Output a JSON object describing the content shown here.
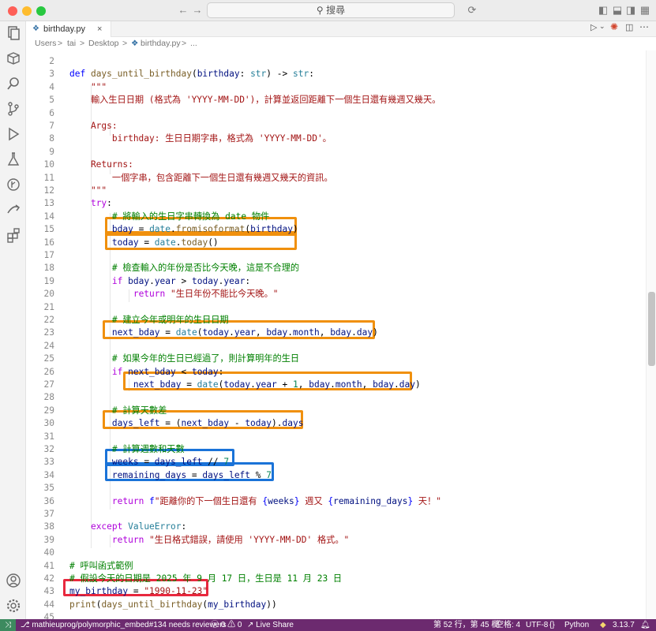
{
  "titlebar": {
    "search": "搜尋"
  },
  "tab": {
    "filename": "birthday.py"
  },
  "breadcrumb": {
    "users": "Users",
    "sep": ">",
    "user": "tai",
    "desktop": "Desktop",
    "file": "birthday.py",
    "more": "..."
  },
  "code_lines": [
    {
      "n": "2",
      "tokens": []
    },
    {
      "n": "3",
      "tokens": [
        [
          "kw",
          "def "
        ],
        [
          "fn",
          "days_until_birthday"
        ],
        [
          "pl",
          "("
        ],
        [
          "var",
          "birthday"
        ],
        [
          "pl",
          ": "
        ],
        [
          "cls",
          "str"
        ],
        [
          "pl",
          ") -> "
        ],
        [
          "cls",
          "str"
        ],
        [
          "pl",
          ":"
        ]
      ]
    },
    {
      "n": "4",
      "tokens": [
        [
          "str",
          "    \"\"\""
        ]
      ]
    },
    {
      "n": "5",
      "tokens": [
        [
          "str",
          "    輸入生日日期 (格式為 'YYYY-MM-DD')，計算並返回距離下一個生日還有幾週又幾天。"
        ]
      ]
    },
    {
      "n": "6",
      "tokens": []
    },
    {
      "n": "7",
      "tokens": [
        [
          "str",
          "    Args:"
        ]
      ]
    },
    {
      "n": "8",
      "tokens": [
        [
          "str",
          "        birthday: 生日日期字串，格式為 'YYYY-MM-DD'。"
        ]
      ]
    },
    {
      "n": "9",
      "tokens": []
    },
    {
      "n": "10",
      "tokens": [
        [
          "str",
          "    Returns:"
        ]
      ]
    },
    {
      "n": "11",
      "tokens": [
        [
          "str",
          "        一個字串，包含距離下一個生日還有幾週又幾天的資訊。"
        ]
      ]
    },
    {
      "n": "12",
      "tokens": [
        [
          "str",
          "    \"\"\""
        ]
      ]
    },
    {
      "n": "13",
      "tokens": [
        [
          "pl",
          "    "
        ],
        [
          "ctl",
          "try"
        ],
        [
          "pl",
          ":"
        ]
      ]
    },
    {
      "n": "14",
      "tokens": [
        [
          "com",
          "        # 將輸入的生日字串轉換為 date 物件"
        ]
      ]
    },
    {
      "n": "15",
      "tokens": [
        [
          "pl",
          "        "
        ],
        [
          "var",
          "bday"
        ],
        [
          "pl",
          " = "
        ],
        [
          "cls",
          "date"
        ],
        [
          "pl",
          "."
        ],
        [
          "fn",
          "fromisoformat"
        ],
        [
          "pl",
          "("
        ],
        [
          "var",
          "birthday"
        ],
        [
          "pl",
          ")"
        ]
      ]
    },
    {
      "n": "16",
      "tokens": [
        [
          "pl",
          "        "
        ],
        [
          "var",
          "today"
        ],
        [
          "pl",
          " = "
        ],
        [
          "cls",
          "date"
        ],
        [
          "pl",
          "."
        ],
        [
          "fn",
          "today"
        ],
        [
          "pl",
          "()"
        ]
      ]
    },
    {
      "n": "17",
      "tokens": []
    },
    {
      "n": "18",
      "tokens": [
        [
          "com",
          "        # 檢查輸入的年份是否比今天晚，這是不合理的"
        ]
      ]
    },
    {
      "n": "19",
      "tokens": [
        [
          "pl",
          "        "
        ],
        [
          "ctl",
          "if "
        ],
        [
          "var",
          "bday"
        ],
        [
          "pl",
          "."
        ],
        [
          "var",
          "year"
        ],
        [
          "pl",
          " > "
        ],
        [
          "var",
          "today"
        ],
        [
          "pl",
          "."
        ],
        [
          "var",
          "year"
        ],
        [
          "pl",
          ":"
        ]
      ]
    },
    {
      "n": "20",
      "tokens": [
        [
          "pl",
          "            "
        ],
        [
          "ctl",
          "return "
        ],
        [
          "str",
          "\"生日年份不能比今天晚。\""
        ]
      ]
    },
    {
      "n": "21",
      "tokens": []
    },
    {
      "n": "22",
      "tokens": [
        [
          "com",
          "        # 建立今年或明年的生日日期"
        ]
      ]
    },
    {
      "n": "23",
      "tokens": [
        [
          "pl",
          "        "
        ],
        [
          "var",
          "next_bday"
        ],
        [
          "pl",
          " = "
        ],
        [
          "cls",
          "date"
        ],
        [
          "pl",
          "("
        ],
        [
          "var",
          "today"
        ],
        [
          "pl",
          "."
        ],
        [
          "var",
          "year"
        ],
        [
          "pl",
          ", "
        ],
        [
          "var",
          "bday"
        ],
        [
          "pl",
          "."
        ],
        [
          "var",
          "month"
        ],
        [
          "pl",
          ", "
        ],
        [
          "var",
          "bday"
        ],
        [
          "pl",
          "."
        ],
        [
          "var",
          "day"
        ],
        [
          "pl",
          ")"
        ]
      ]
    },
    {
      "n": "24",
      "tokens": []
    },
    {
      "n": "25",
      "tokens": [
        [
          "com",
          "        # 如果今年的生日已經過了，則計算明年的生日"
        ]
      ]
    },
    {
      "n": "26",
      "tokens": [
        [
          "pl",
          "        "
        ],
        [
          "ctl",
          "if "
        ],
        [
          "var",
          "next_bday"
        ],
        [
          "pl",
          " < "
        ],
        [
          "var",
          "today"
        ],
        [
          "pl",
          ":"
        ]
      ]
    },
    {
      "n": "27",
      "tokens": [
        [
          "pl",
          "            "
        ],
        [
          "var",
          "next_bday"
        ],
        [
          "pl",
          " = "
        ],
        [
          "cls",
          "date"
        ],
        [
          "pl",
          "("
        ],
        [
          "var",
          "today"
        ],
        [
          "pl",
          "."
        ],
        [
          "var",
          "year"
        ],
        [
          "pl",
          " + "
        ],
        [
          "num",
          "1"
        ],
        [
          "pl",
          ", "
        ],
        [
          "var",
          "bday"
        ],
        [
          "pl",
          "."
        ],
        [
          "var",
          "month"
        ],
        [
          "pl",
          ", "
        ],
        [
          "var",
          "bday"
        ],
        [
          "pl",
          "."
        ],
        [
          "var",
          "day"
        ],
        [
          "pl",
          ")"
        ]
      ]
    },
    {
      "n": "28",
      "tokens": []
    },
    {
      "n": "29",
      "tokens": [
        [
          "com",
          "        # 計算天數差"
        ]
      ]
    },
    {
      "n": "30",
      "tokens": [
        [
          "pl",
          "        "
        ],
        [
          "var",
          "days_left"
        ],
        [
          "pl",
          " = ("
        ],
        [
          "var",
          "next_bday"
        ],
        [
          "pl",
          " - "
        ],
        [
          "var",
          "today"
        ],
        [
          "pl",
          ")."
        ],
        [
          "var",
          "days"
        ]
      ]
    },
    {
      "n": "31",
      "tokens": []
    },
    {
      "n": "32",
      "tokens": [
        [
          "com",
          "        # 計算週數和天數"
        ]
      ]
    },
    {
      "n": "33",
      "tokens": [
        [
          "pl",
          "        "
        ],
        [
          "var",
          "weeks"
        ],
        [
          "pl",
          " = "
        ],
        [
          "var",
          "days_left"
        ],
        [
          "pl",
          " // "
        ],
        [
          "num",
          "7"
        ]
      ]
    },
    {
      "n": "34",
      "tokens": [
        [
          "pl",
          "        "
        ],
        [
          "var",
          "remaining_days"
        ],
        [
          "pl",
          " = "
        ],
        [
          "var",
          "days_left"
        ],
        [
          "pl",
          " % "
        ],
        [
          "num",
          "7"
        ]
      ]
    },
    {
      "n": "35",
      "tokens": []
    },
    {
      "n": "36",
      "tokens": [
        [
          "pl",
          "        "
        ],
        [
          "ctl",
          "return "
        ],
        [
          "kw",
          "f"
        ],
        [
          "str",
          "\"距離你的下一個生日還有 "
        ],
        [
          "kw",
          "{"
        ],
        [
          "var",
          "weeks"
        ],
        [
          "kw",
          "}"
        ],
        [
          "str",
          " 週又 "
        ],
        [
          "kw",
          "{"
        ],
        [
          "var",
          "remaining_days"
        ],
        [
          "kw",
          "}"
        ],
        [
          "str",
          " 天！\""
        ]
      ]
    },
    {
      "n": "37",
      "tokens": []
    },
    {
      "n": "38",
      "tokens": [
        [
          "pl",
          "    "
        ],
        [
          "ctl",
          "except "
        ],
        [
          "cls",
          "ValueError"
        ],
        [
          "pl",
          ":"
        ]
      ]
    },
    {
      "n": "39",
      "tokens": [
        [
          "pl",
          "        "
        ],
        [
          "ctl",
          "return "
        ],
        [
          "str",
          "\"生日格式錯誤，請使用 'YYYY-MM-DD' 格式。\""
        ]
      ]
    },
    {
      "n": "40",
      "tokens": []
    },
    {
      "n": "41",
      "tokens": [
        [
          "com",
          "# 呼叫函式範例"
        ]
      ]
    },
    {
      "n": "42",
      "tokens": [
        [
          "com",
          "# 假設今天的日期是 2025 年 9 月 17 日，生日是 11 月 23 日"
        ]
      ]
    },
    {
      "n": "43",
      "tokens": [
        [
          "var",
          "my_birthday"
        ],
        [
          "pl",
          " = "
        ],
        [
          "str",
          "\"1990-11-23\""
        ]
      ]
    },
    {
      "n": "44",
      "tokens": [
        [
          "fn",
          "print"
        ],
        [
          "pl",
          "("
        ],
        [
          "fn",
          "days_until_birthday"
        ],
        [
          "pl",
          "("
        ],
        [
          "var",
          "my_birthday"
        ],
        [
          "pl",
          "))"
        ]
      ]
    },
    {
      "n": "45",
      "tokens": []
    }
  ],
  "status": {
    "branch": "mathieuprog/polymorphic_embed#134 needs reviewers",
    "problems": "0",
    "warnings": "0",
    "liveshare": "Live Share",
    "position": "第 52 行，第 45 欄",
    "spaces": "空格: 4",
    "encoding": "UTF-8",
    "eol": "{}",
    "language": "Python",
    "version": "3.13.7"
  },
  "colors": {
    "orange": "#f0900d",
    "blue": "#1a73d8",
    "red": "#e8283e",
    "statusbar": "#6c2a6f"
  }
}
